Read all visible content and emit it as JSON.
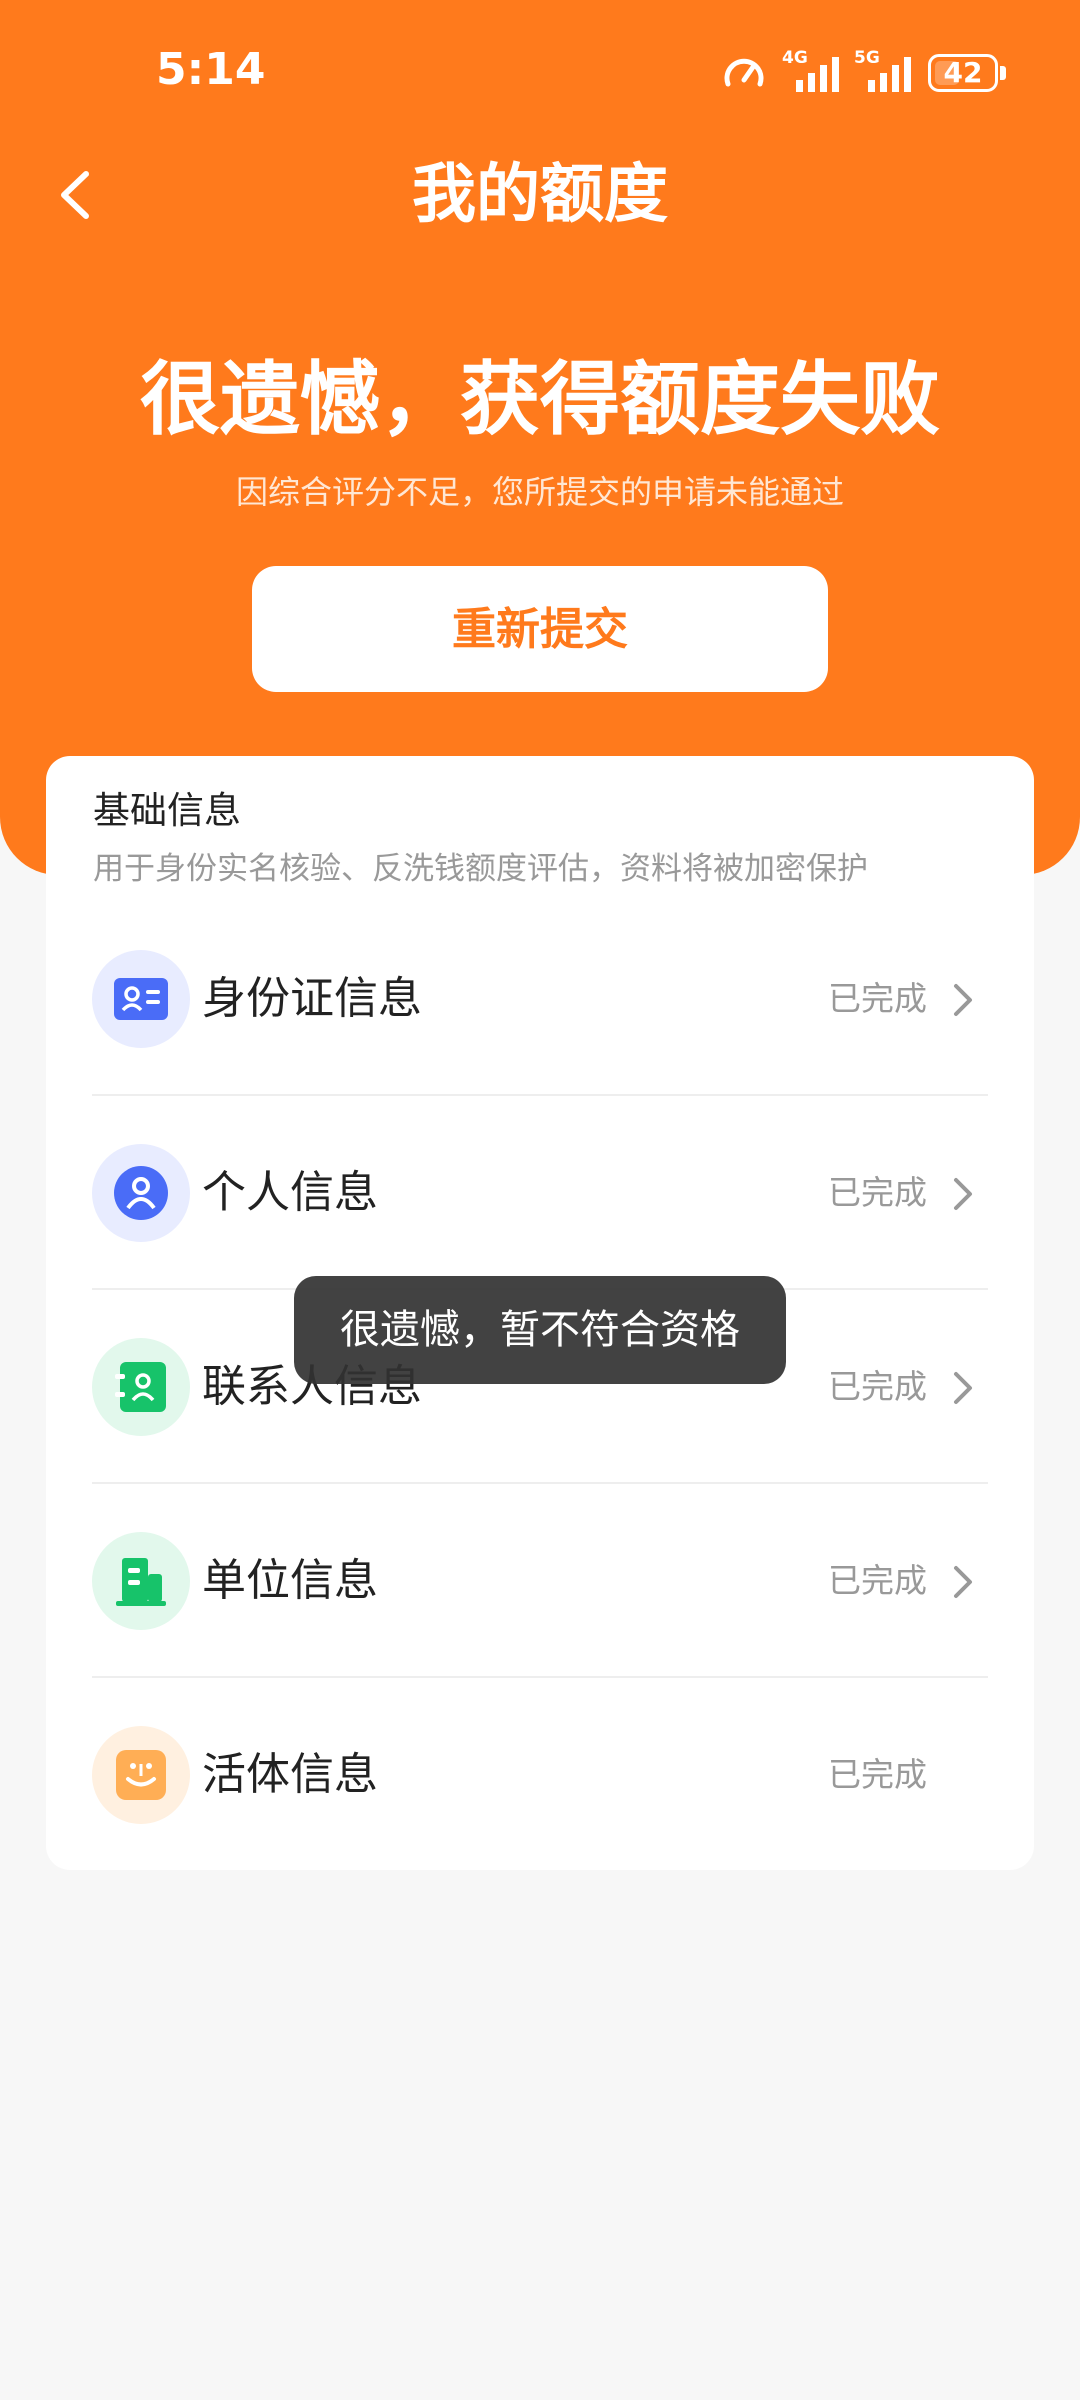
{
  "status_bar": {
    "time": "5:14",
    "network1": "4G",
    "network2": "5G",
    "battery_level": 42,
    "battery_label": "42"
  },
  "header": {
    "title": "我的额度",
    "back_icon": "chevron-left-icon"
  },
  "result": {
    "title": "很遗憾，获得额度失败",
    "subtitle": "因综合评分不足，您所提交的申请未能通过",
    "resubmit_label": "重新提交"
  },
  "basic_info": {
    "title": "基础信息",
    "description": "用于身份实名核验、反洗钱额度评估，资料将被加密保护",
    "items": [
      {
        "label": "身份证信息",
        "status": "已完成",
        "icon": "id-card-icon",
        "has_chevron": true
      },
      {
        "label": "个人信息",
        "status": "已完成",
        "icon": "person-icon",
        "has_chevron": true
      },
      {
        "label": "联系人信息",
        "status": "已完成",
        "icon": "contact-book-icon",
        "has_chevron": true
      },
      {
        "label": "单位信息",
        "status": "已完成",
        "icon": "building-icon",
        "has_chevron": true
      },
      {
        "label": "活体信息",
        "status": "已完成",
        "icon": "face-scan-icon",
        "has_chevron": false
      }
    ]
  },
  "toast": {
    "message": "很遗憾，暂不符合资格"
  },
  "colors": {
    "brand_orange": "#ff7a1c",
    "background": "#f7f7f7",
    "status_gray": "#999999"
  }
}
